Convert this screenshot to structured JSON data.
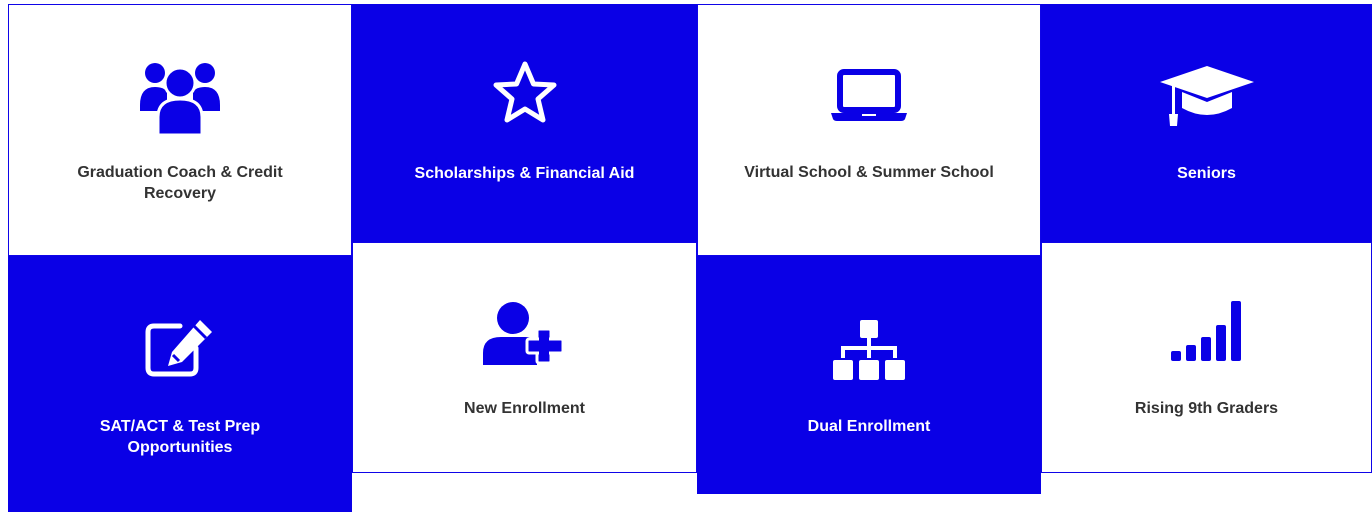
{
  "colors": {
    "brand_blue": "#0a00e6",
    "text_dark": "#333333",
    "white": "#ffffff"
  },
  "tiles": [
    {
      "label": "Graduation Coach & Credit Recovery",
      "icon": "users-group-icon",
      "style": "white"
    },
    {
      "label": "Scholarships & Financial Aid",
      "icon": "star-icon",
      "style": "blue"
    },
    {
      "label": "Virtual School & Summer School",
      "icon": "laptop-icon",
      "style": "white"
    },
    {
      "label": "Seniors",
      "icon": "graduation-cap-icon",
      "style": "blue"
    },
    {
      "label": "SAT/ACT & Test Prep Opportunities",
      "icon": "edit-icon",
      "style": "blue"
    },
    {
      "label": "New Enrollment",
      "icon": "user-plus-icon",
      "style": "white"
    },
    {
      "label": "Dual Enrollment",
      "icon": "sitemap-icon",
      "style": "blue"
    },
    {
      "label": "Rising 9th Graders",
      "icon": "signal-bars-icon",
      "style": "white"
    }
  ]
}
